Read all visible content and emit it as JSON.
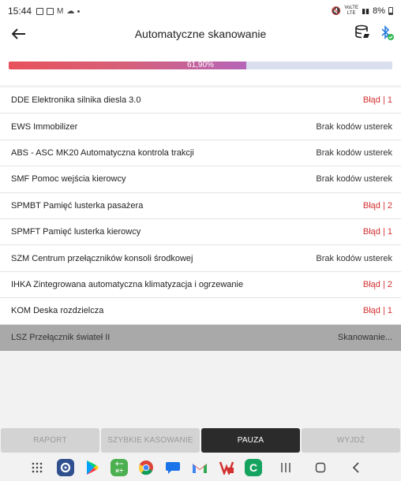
{
  "status_bar": {
    "time": "15:44",
    "battery": "8%",
    "network": "VoLTE LTE"
  },
  "header": {
    "title": "Automatyczne skanowanie",
    "back_icon": "arrow-left-icon",
    "db_icon": "database-icon",
    "bluetooth_icon": "bluetooth-connected-icon"
  },
  "progress": {
    "label": "61,90%",
    "value_percent": 61.9,
    "colors": {
      "start": "#e8525b",
      "end": "#b565b8",
      "track": "#d9dfef"
    }
  },
  "modules": [
    {
      "name": "DDE Elektronika silnika diesla 3.0",
      "status": "Błąd | 1",
      "type": "error"
    },
    {
      "name": "EWS Immobilizer",
      "status": "Brak kodów usterek",
      "type": "ok"
    },
    {
      "name": "ABS - ASC MK20 Automatyczna kontrola trakcji",
      "status": "Brak kodów usterek",
      "type": "ok"
    },
    {
      "name": "SMF Pomoc wejścia kierowcy",
      "status": "Brak kodów usterek",
      "type": "ok"
    },
    {
      "name": "SPMBT Pamięć lusterka pasażera",
      "status": "Błąd | 2",
      "type": "error"
    },
    {
      "name": "SPMFT Pamięć lusterka kierowcy",
      "status": "Błąd | 1",
      "type": "error"
    },
    {
      "name": "SZM Centrum przełączników konsoli środkowej",
      "status": "Brak kodów usterek",
      "type": "ok"
    },
    {
      "name": "IHKA Zintegrowana automatyczna klimatyzacja i ogrzewanie",
      "status": "Błąd | 2",
      "type": "error"
    },
    {
      "name": "KOM Deska rozdzielcza",
      "status": "Błąd | 1",
      "type": "error"
    },
    {
      "name": "LSZ Przełącznik świateł II",
      "status": "Skanowanie...",
      "type": "scanning"
    }
  ],
  "buttons": {
    "report": "RAPORT",
    "quick_clear": "SZYBKIE KASOWANIE",
    "pause": "PAUZA",
    "exit": "WYJDŹ"
  },
  "colors": {
    "error": "#d32f2f",
    "active_button": "#2b2b2b",
    "scanning_row": "#a9a9a9"
  },
  "nav_bar": {
    "apps": [
      "apps-grid-icon",
      "settings-icon",
      "play-store-icon",
      "calculator-icon",
      "chrome-icon",
      "messages-icon",
      "gmail-icon",
      "wallet-icon",
      "phone-icon"
    ],
    "system": [
      "recents-icon",
      "home-icon",
      "back-icon"
    ]
  }
}
